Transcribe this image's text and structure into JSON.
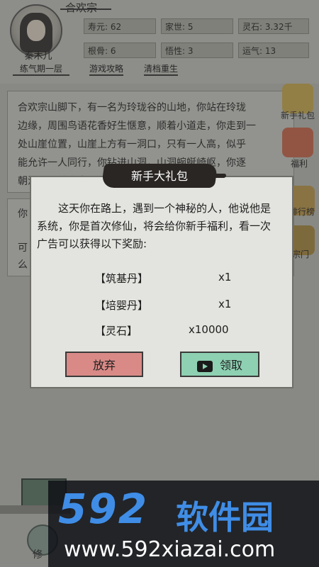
{
  "header": {
    "sect": "合欢宗",
    "name": "秦木儿",
    "rank": "练气期一层",
    "guide_link": "游戏攻略",
    "reset_link": "清档重生",
    "stats": [
      {
        "label": "寿元: 62"
      },
      {
        "label": "家世: 5"
      },
      {
        "label": "灵石: 3.32千"
      },
      {
        "label": "根骨: 6"
      },
      {
        "label": "悟性: 3"
      },
      {
        "label": "运气: 13"
      }
    ]
  },
  "story": {
    "line1": "合欢宗山脚下，有一名为玲珑谷的山地，你站在玲珑",
    "line2": "边缘，周围鸟语花香好生惬意，顺着小道走，你走到一",
    "line3": "处山崖位置，山崖上方有一洞口，只有一人高，似乎",
    "line4": "能允许一人同行，你钻进山洞，山洞蜿蜒崎岖，你逐",
    "line5": "朝洞口深处走去",
    "frag1": "你",
    "frag2": "可",
    "frag3": "么"
  },
  "side": {
    "gift_label": "新手礼包",
    "welfare_label": "福利",
    "rank_label": "排行榜",
    "sect_label": "宗门"
  },
  "bottom": {
    "cultivate": "修"
  },
  "dialog": {
    "title": "新手大礼包",
    "message": "这天你在路上，遇到一个神秘的人，他说他是系统，你是首次修仙，将会给你新手福利，看一次广告可以获得以下奖励:",
    "rewards": [
      {
        "name": "【筑基丹】",
        "qty": "x1"
      },
      {
        "name": "【培婴丹】",
        "qty": "x1"
      },
      {
        "name": "【灵石】",
        "qty": "x10000"
      }
    ],
    "giveup": "放弃",
    "claim": "领取"
  },
  "watermark": {
    "logo": "592",
    "cn": "软件园",
    "url": "www.592xiazai.com"
  },
  "colors": {
    "giveup": "#d98a86",
    "claim": "#8ed0b2",
    "watermark_blue": "#3f8de6"
  }
}
